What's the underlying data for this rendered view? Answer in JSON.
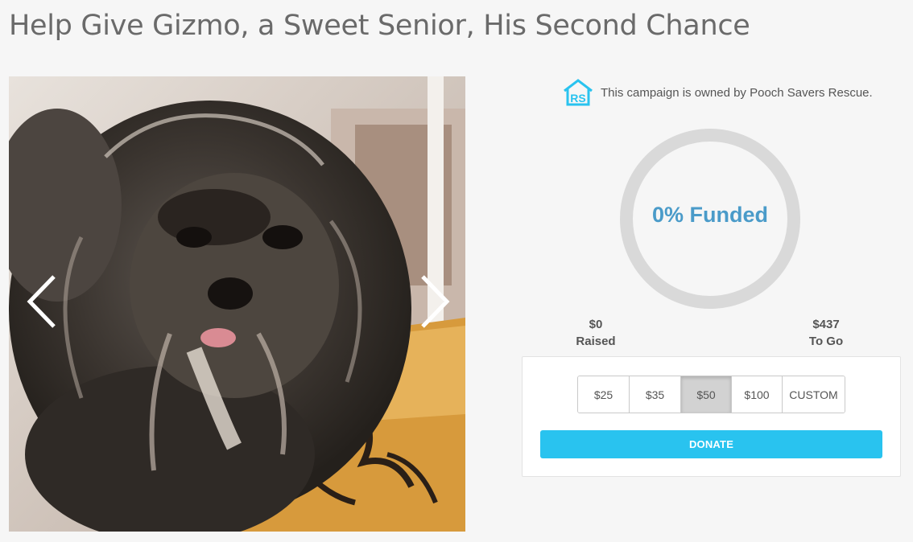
{
  "page": {
    "title": "Help Give Gizmo, a Sweet Senior, His Second Chance"
  },
  "carousel": {
    "prev_icon": "chevron-left-icon",
    "next_icon": "chevron-right-icon"
  },
  "owner": {
    "logo_text": "RS",
    "logo_icon": "house-icon",
    "text": "This campaign is owned by Pooch Savers Rescue."
  },
  "progress": {
    "label": "0% Funded",
    "percent": 0,
    "ring_color": "#d9d9d9",
    "label_color": "#4a9bc9"
  },
  "stats": {
    "raised_value": "$0",
    "raised_label": "Raised",
    "togo_value": "$437",
    "togo_label": "To Go"
  },
  "donation": {
    "amounts": [
      "$25",
      "$35",
      "$50",
      "$100",
      "CUSTOM"
    ],
    "selected": "$50",
    "donate_label": "DONATE",
    "accent": "#29c3ef"
  }
}
